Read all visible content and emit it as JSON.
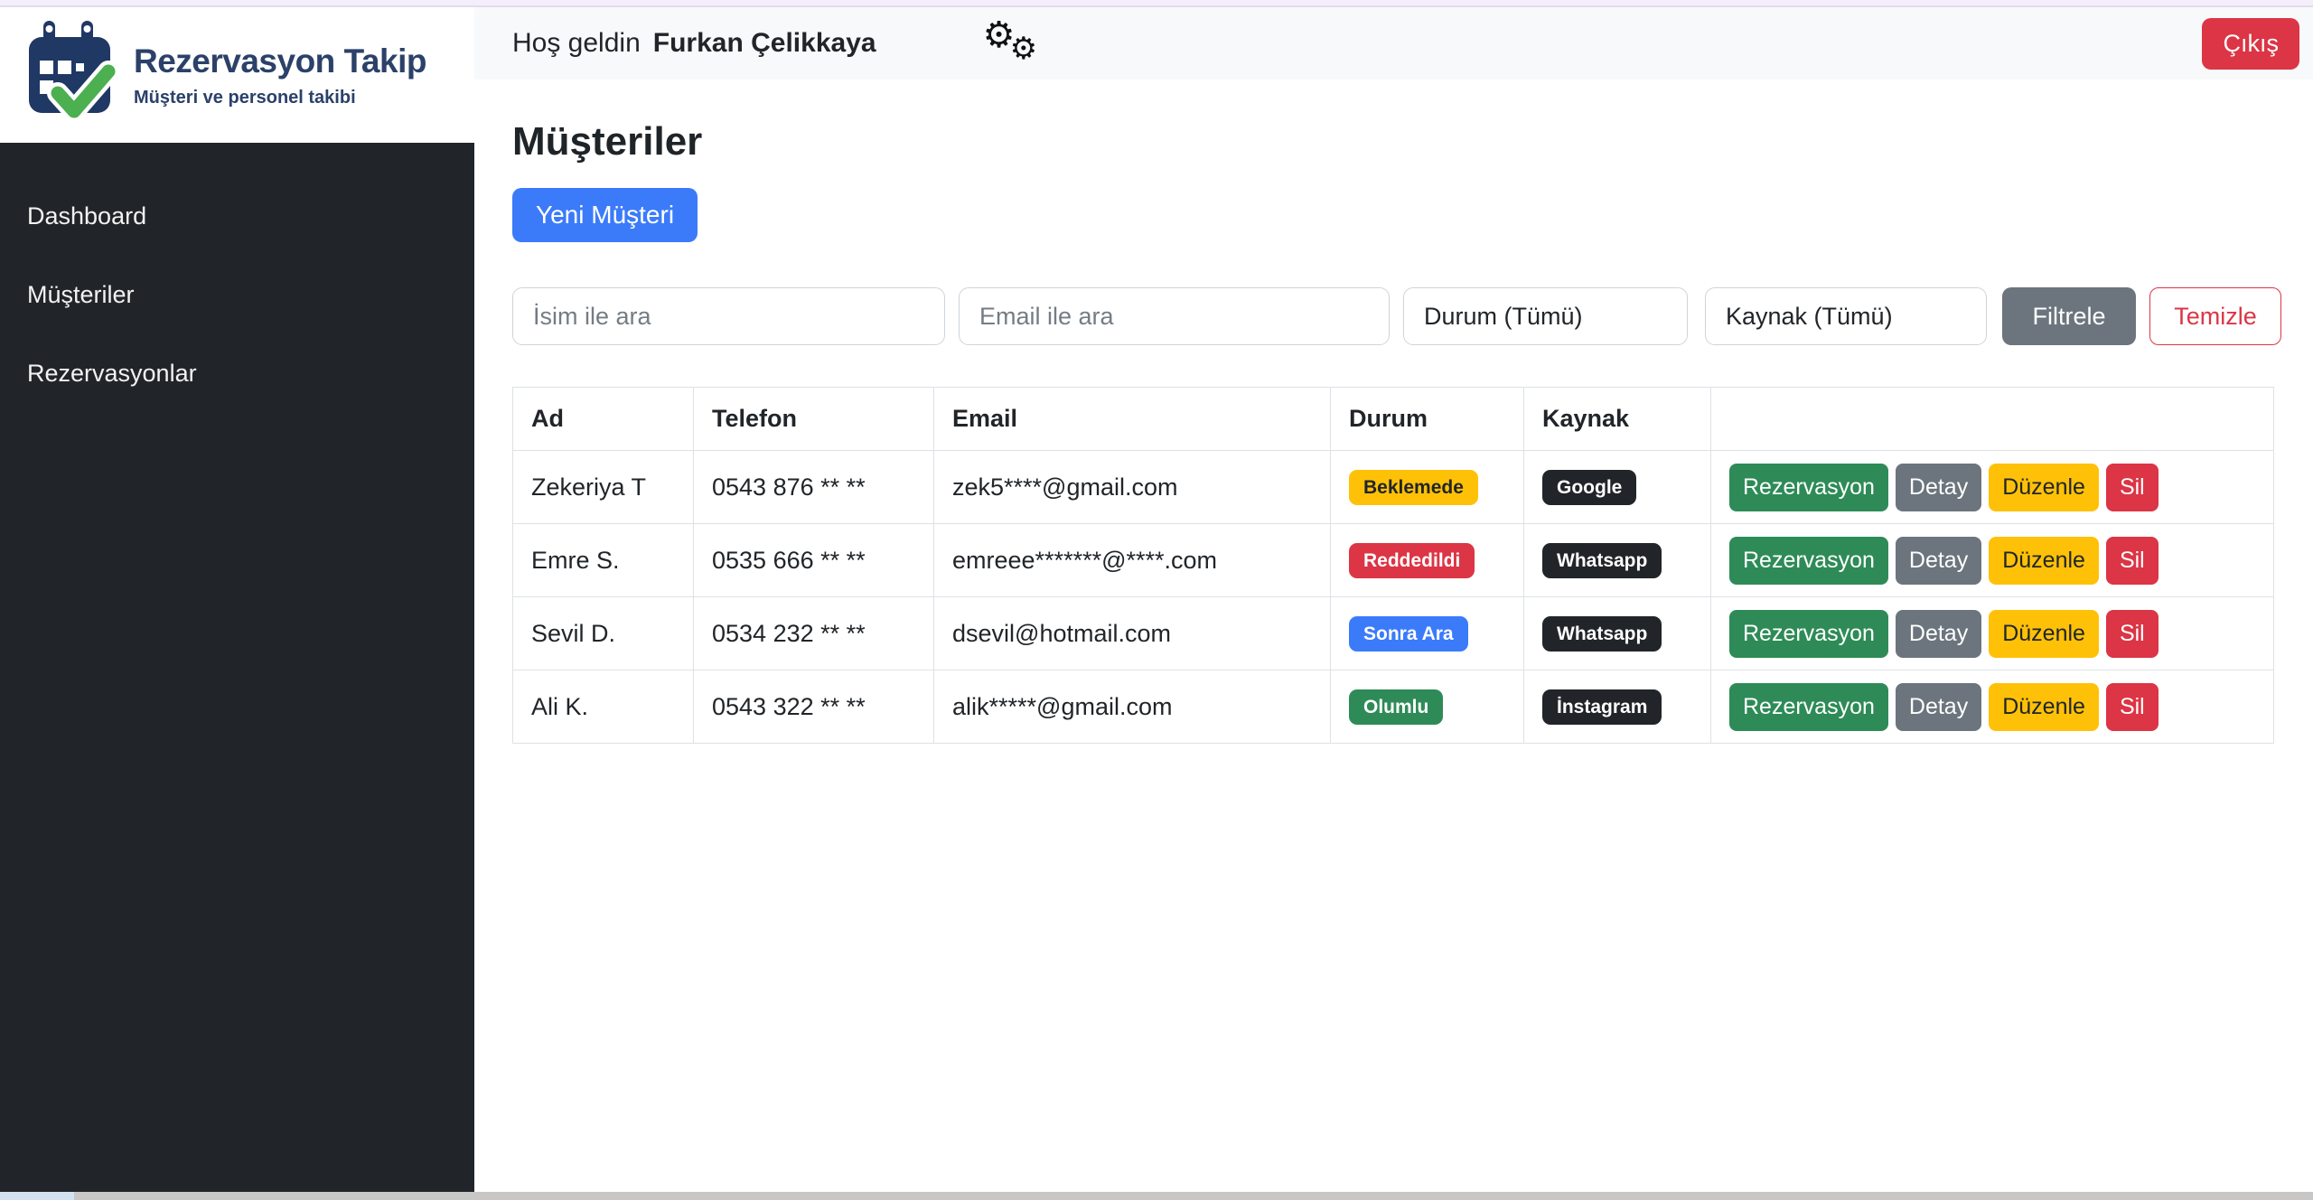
{
  "logo": {
    "title": "Rezervasyon Takip",
    "tagline": "Müşteri ve personel takibi",
    "icon": "calendar-check-icon",
    "brand_navy": "#2b4169",
    "check_green": "#4caf50"
  },
  "sidebar": {
    "items": [
      {
        "label": "Dashboard"
      },
      {
        "label": "Müşteriler"
      },
      {
        "label": "Rezervasyonlar"
      }
    ],
    "bg_color": "#212529"
  },
  "header": {
    "greeting": "Hoş geldin",
    "username": "Furkan Çelikkaya",
    "settings_icon": "gears-icon",
    "logout_label": "Çıkış",
    "logout_color": "#dc3545"
  },
  "main": {
    "title": "Müşteriler",
    "new_customer_label": "Yeni Müşteri",
    "new_customer_color": "#3b7bfa",
    "filters": {
      "name_placeholder": "İsim ile ara",
      "email_placeholder": "Email ile ara",
      "status_value": "Durum (Tümü)",
      "source_value": "Kaynak (Tümü)",
      "filter_label": "Filtrele",
      "clear_label": "Temizle"
    },
    "table": {
      "headers": [
        "Ad",
        "Telefon",
        "Email",
        "Durum",
        "Kaynak",
        ""
      ],
      "source_badge": {
        "bg": "#212529",
        "fg": "#ffffff"
      },
      "action_buttons": [
        {
          "key": "rezervasyon",
          "label": "Rezervasyon",
          "bg": "#2e8b57",
          "fg": "#ffffff"
        },
        {
          "key": "detay",
          "label": "Detay",
          "bg": "#6c757d",
          "fg": "#ffffff"
        },
        {
          "key": "duzenle",
          "label": "Düzenle",
          "bg": "#ffc107",
          "fg": "#212529"
        },
        {
          "key": "sil",
          "label": "Sil",
          "bg": "#dc3545",
          "fg": "#ffffff"
        }
      ],
      "rows": [
        {
          "name": "Zekeriya T",
          "phone": "0543 876 ** **",
          "email": "zek5****@gmail.com",
          "status": "Beklemede",
          "status_bg": "#ffc107",
          "status_fg": "#212529",
          "source": "Google"
        },
        {
          "name": "Emre S.",
          "phone": "0535 666 ** **",
          "email": "emreee*******@****.com",
          "status": "Reddedildi",
          "status_bg": "#dc3545",
          "status_fg": "#ffffff",
          "source": "Whatsapp"
        },
        {
          "name": "Sevil D.",
          "phone": "0534 232 ** **",
          "email": "dsevil@hotmail.com",
          "status": "Sonra Ara",
          "status_bg": "#3b7bfa",
          "status_fg": "#ffffff",
          "source": "Whatsapp"
        },
        {
          "name": "Ali K.",
          "phone": "0543 322 ** **",
          "email": "alik*****@gmail.com",
          "status": "Olumlu",
          "status_bg": "#2e8b57",
          "status_fg": "#ffffff",
          "source": "İnstagram"
        }
      ]
    }
  }
}
